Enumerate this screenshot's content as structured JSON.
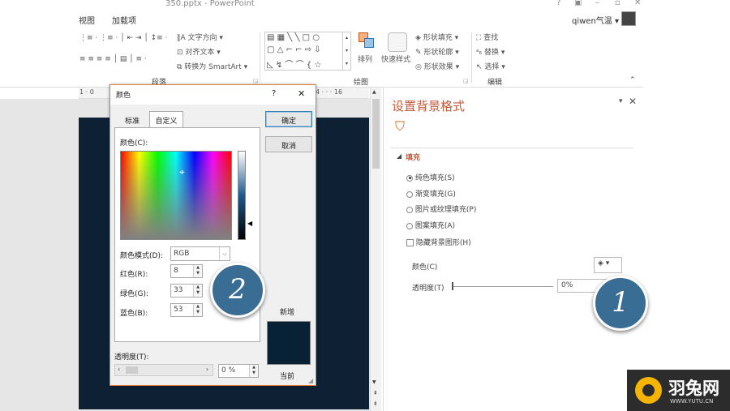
{
  "titlebar": {
    "title": "350.pptx - PowerPoint",
    "controls": [
      "?",
      "▣",
      "–",
      "▫",
      "✕"
    ]
  },
  "menu": {
    "tab_view": "视图",
    "tab_addins": "加载项",
    "user": "qiwen气温 ▾"
  },
  "ribbon": {
    "text_direction": "文字方向 ▾",
    "align_text": "对齐文本 ▾",
    "convert_smartart": "转换为 SmartArt ▾",
    "paragraph_label": "段落",
    "arrange": "排列",
    "quick_styles": "快速样式",
    "shape_fill": "形状填充 ▾",
    "shape_outline": "形状轮廓 ▾",
    "shape_effects": "形状效果 ▾",
    "drawing_label": "绘图",
    "find": "查找",
    "replace": "替换 ▾",
    "select": "选择 ▾",
    "editing_label": "编辑"
  },
  "ruler": {
    "left": "1 · 0",
    "right": "4 · · · 16"
  },
  "pane": {
    "title": "设置背景格式",
    "section": "填充",
    "options": [
      {
        "label": "纯色填充(S)",
        "checked": true
      },
      {
        "label": "渐变填充(G)",
        "checked": false
      },
      {
        "label": "图片或纹理填充(P)",
        "checked": false
      },
      {
        "label": "图案填充(A)",
        "checked": false
      }
    ],
    "hide_graphics": "隐藏背景图形(H)",
    "color_label": "颜色(C)",
    "transparency_label": "透明度(T)",
    "transparency_value": "0%"
  },
  "dialog": {
    "title": "颜色",
    "help": "?",
    "close": "✕",
    "tab_standard": "标准",
    "tab_custom": "自定义",
    "colors_label": "颜色(C):",
    "mode_label": "颜色模式(D):",
    "mode_value": "RGB",
    "red_label": "红色(R):",
    "red_value": "8",
    "green_label": "绿色(G):",
    "green_value": "33",
    "blue_label": "蓝色(B):",
    "blue_value": "53",
    "transparency_label": "透明度(T):",
    "transparency_value": "0 %",
    "ok": "确定",
    "cancel": "取消",
    "new_label": "新增",
    "current_label": "当前",
    "new_color": "#082135",
    "current_color": "#082135"
  },
  "callouts": {
    "one": "1",
    "two": "2"
  },
  "logo": {
    "name": "羽兔网",
    "url": "WWW.YUTU.CN"
  }
}
